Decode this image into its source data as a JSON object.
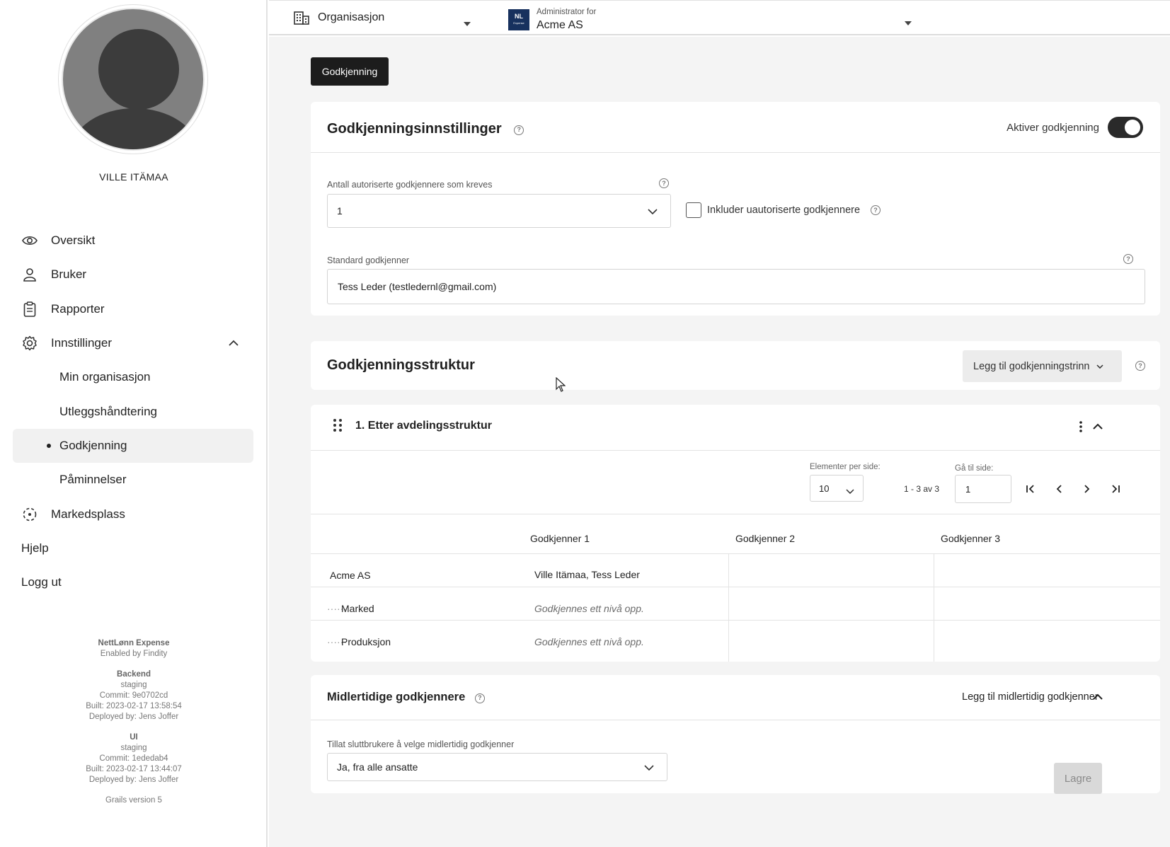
{
  "user": {
    "name": "VILLE ITÄMAA"
  },
  "nav": {
    "overview": "Oversikt",
    "user": "Bruker",
    "reports": "Rapporter",
    "settings": "Innstillinger",
    "my_org": "Min organisasjon",
    "expense_handling": "Utleggshåndtering",
    "approval": "Godkjenning",
    "reminders": "Påminnelser",
    "marketplace": "Markedsplass",
    "help": "Hjelp",
    "logout": "Logg ut"
  },
  "footer": {
    "product": "NettLønn Expense",
    "enabled_by": "Enabled by Findity",
    "backend_title": "Backend",
    "backend_env": "staging",
    "backend_commit": "Commit: 9e0702cd",
    "backend_built": "Built: 2023-02-17 13:58:54",
    "backend_deployed": "Deployed by: Jens Joffer",
    "ui_title": "UI",
    "ui_env": "staging",
    "ui_commit": "Commit: 1ededab4",
    "ui_built": "Built: 2023-02-17 13:44:07",
    "ui_deployed": "Deployed by: Jens Joffer",
    "grails": "Grails version 5"
  },
  "topbar": {
    "org_label": "Organisasjon",
    "admin_for": "Administrator for",
    "company": "Acme AS",
    "logo_text": "NL",
    "logo_sub": "Expense"
  },
  "tab": "Godkjenning",
  "settings_card": {
    "title": "Godkjenningsinnstillinger",
    "toggle_label": "Aktiver godkjenning",
    "toggle_on": true,
    "approvers_label": "Antall autoriserte godkjennere som kreves",
    "approvers_value": "1",
    "include_unauth": "Inkluder uautoriserte godkjennere",
    "default_label": "Standard godkjenner",
    "default_value": "Tess Leder (testledernl@gmail.com)"
  },
  "structure_card": {
    "title": "Godkjenningsstruktur",
    "add_step": "Legg til godkjenningstrinn"
  },
  "step_card": {
    "title": "1. Etter avdelingsstruktur",
    "per_page_label": "Elementer per side:",
    "per_page_value": "10",
    "count": "1 - 3 av 3",
    "goto_label": "Gå til side:",
    "goto_value": "1",
    "columns": [
      "Godkjenner 1",
      "Godkjenner 2",
      "Godkjenner 3"
    ],
    "rows": [
      {
        "name": "Acme AS",
        "approver1": "Ville Itämaa, Tess Leder"
      },
      {
        "name": "Marked",
        "approver1": "Godkjennes ett nivå opp."
      },
      {
        "name": "Produksjon",
        "approver1": "Godkjennes ett nivå opp."
      }
    ]
  },
  "temp_card": {
    "title": "Midlertidige godkjennere",
    "add_temp": "Legg til midlertidig godkjenner",
    "allow_label": "Tillat sluttbrukere å velge midlertidig godkjenner",
    "allow_value": "Ja, fra alle ansatte"
  },
  "save": "Lagre"
}
